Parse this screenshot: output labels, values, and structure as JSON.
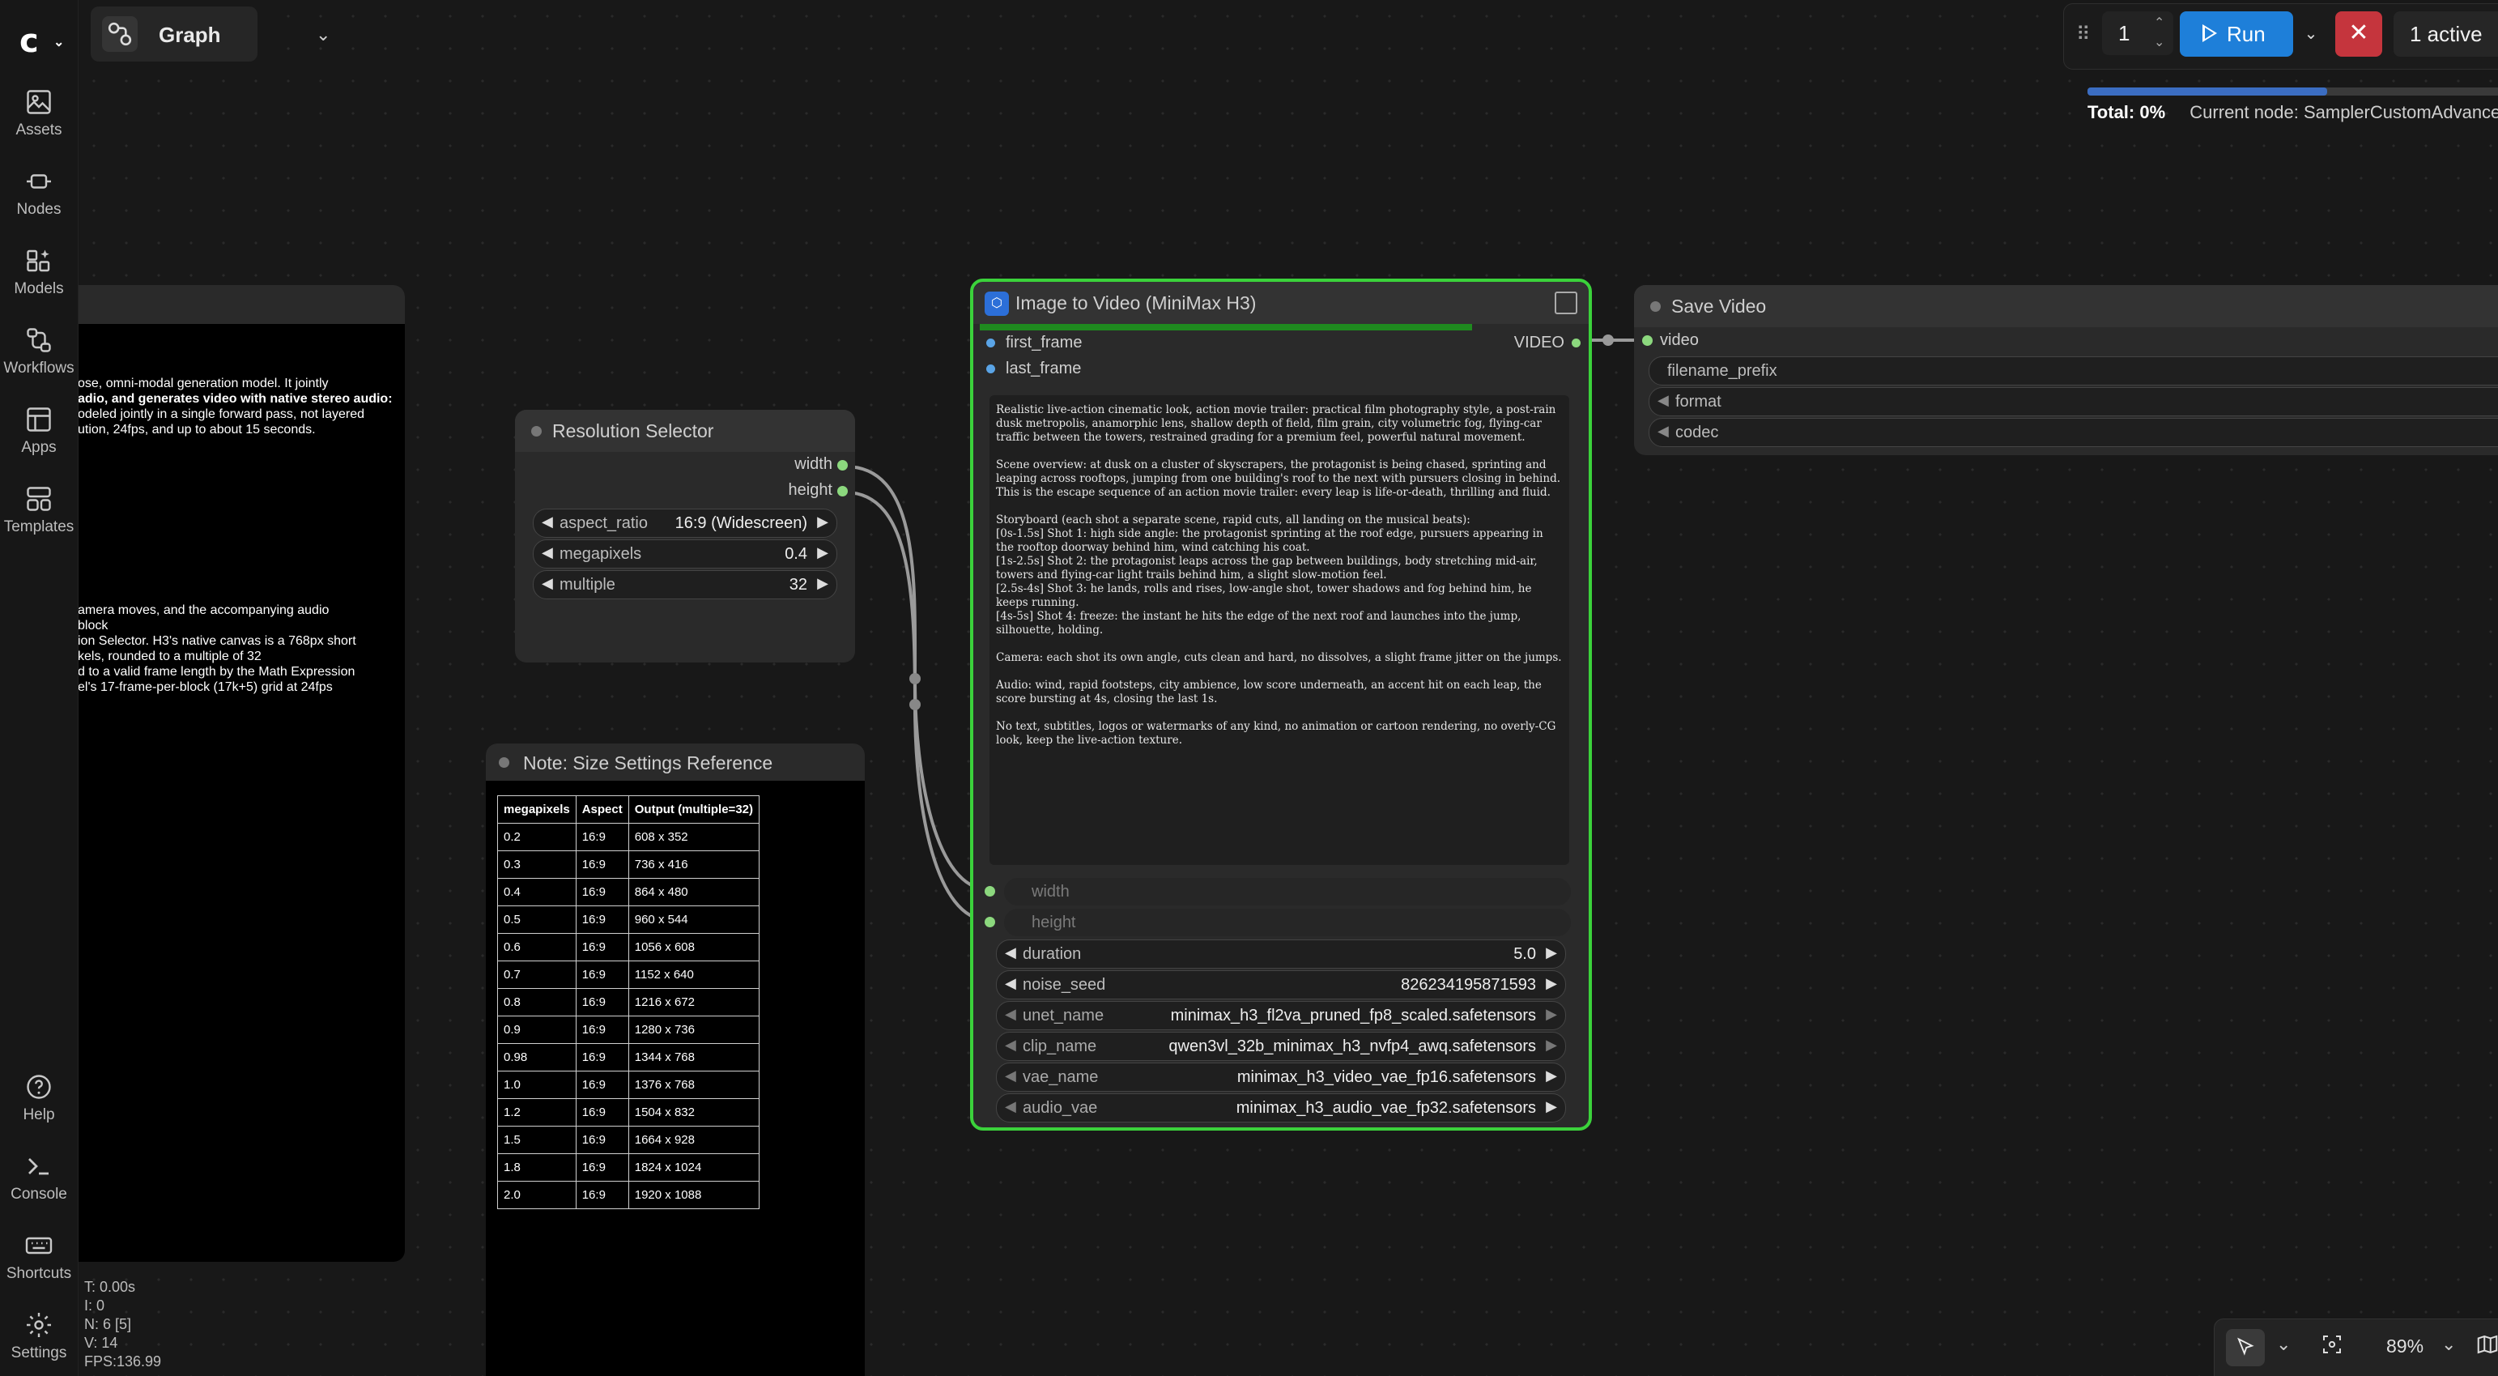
{
  "sidebar": {
    "items": [
      {
        "label": "Assets",
        "icon": "image-icon"
      },
      {
        "label": "Nodes",
        "icon": "node-icon"
      },
      {
        "label": "Models",
        "icon": "models-icon"
      },
      {
        "label": "Workflows",
        "icon": "workflow-icon"
      },
      {
        "label": "Apps",
        "icon": "apps-icon"
      },
      {
        "label": "Templates",
        "icon": "templates-icon"
      }
    ],
    "bottom_items": [
      {
        "label": "Help",
        "icon": "help-icon"
      },
      {
        "label": "Console",
        "icon": "console-icon"
      },
      {
        "label": "Shortcuts",
        "icon": "keyboard-icon"
      },
      {
        "label": "Settings",
        "icon": "gear-icon"
      }
    ]
  },
  "topbar": {
    "graph_label": "Graph",
    "queue_count": "1",
    "run_label": "Run",
    "active_label": "1 active",
    "progress": 0.57,
    "total_label": "Total:",
    "total_value": "0%",
    "current_node_label": "Current node:",
    "current_node_value": "SamplerCustomAdvanced"
  },
  "left_note": {
    "lines": [
      "ose, omni-modal generation model. It jointly",
      "adio, and generates video with native stereo audio:",
      "odeled jointly in a single forward pass, not layered",
      "ution, 24fps, and up to about 15 seconds."
    ],
    "lines2": [
      "amera moves, and the accompanying audio",
      "block",
      "ion Selector. H3's native canvas is a 768px short",
      "kels, rounded to a multiple of 32",
      "d to a valid frame length by the Math Expression",
      "el's 17-frame-per-block (17k+5) grid at 24fps"
    ]
  },
  "resolution_node": {
    "title": "Resolution Selector",
    "outputs": [
      "width",
      "height"
    ],
    "widgets": [
      {
        "name": "aspect_ratio",
        "value": "16:9 (Widescreen)"
      },
      {
        "name": "megapixels",
        "value": "0.4"
      },
      {
        "name": "multiple",
        "value": "32"
      }
    ]
  },
  "size_note": {
    "title": "Note: Size Settings Reference",
    "headers": [
      "megapixels",
      "Aspect",
      "Output (multiple=32)"
    ],
    "rows": [
      [
        "0.2",
        "16:9",
        "608 x 352"
      ],
      [
        "0.3",
        "16:9",
        "736 x 416"
      ],
      [
        "0.4",
        "16:9",
        "864 x 480"
      ],
      [
        "0.5",
        "16:9",
        "960 x 544"
      ],
      [
        "0.6",
        "16:9",
        "1056 x 608"
      ],
      [
        "0.7",
        "16:9",
        "1152 x 640"
      ],
      [
        "0.8",
        "16:9",
        "1216 x 672"
      ],
      [
        "0.9",
        "16:9",
        "1280 x 736"
      ],
      [
        "0.98",
        "16:9",
        "1344 x 768"
      ],
      [
        "1.0",
        "16:9",
        "1376 x 768"
      ],
      [
        "1.2",
        "16:9",
        "1504 x 832"
      ],
      [
        "1.5",
        "16:9",
        "1664 x 928"
      ],
      [
        "1.8",
        "16:9",
        "1824 x 1024"
      ],
      [
        "2.0",
        "16:9",
        "1920 x 1088"
      ]
    ]
  },
  "main_node": {
    "title": "Image to Video (MiniMax H3)",
    "progress": 0.8,
    "inputs": [
      "first_frame",
      "last_frame"
    ],
    "output": "VIDEO",
    "prompt": "Realistic live-action cinematic look, action movie trailer: practical film photography style, a post-rain dusk metropolis, anamorphic lens, shallow depth of field, film grain, city volumetric fog, flying-car traffic between the towers, restrained grading for a premium feel, powerful natural movement.\n\nScene overview: at dusk on a cluster of skyscrapers, the protagonist is being chased, sprinting and leaping across rooftops, jumping from one building's roof to the next with pursuers closing in behind. This is the escape sequence of an action movie trailer: every leap is life-or-death, thrilling and fluid.\n\nStoryboard (each shot a separate scene, rapid cuts, all landing on the musical beats):\n[0s-1.5s] Shot 1: high side angle: the protagonist sprinting at the roof edge, pursuers appearing in the rooftop doorway behind him, wind catching his coat.\n[1s-2.5s] Shot 2: the protagonist leaps across the gap between buildings, body stretching mid-air, towers and flying-car light trails behind him, a slight slow-motion feel.\n[2.5s-4s] Shot 3: he lands, rolls and rises, low-angle shot, tower shadows and fog behind him, he keeps running.\n[4s-5s] Shot 4: freeze: the instant he hits the edge of the next roof and launches into the jump, silhouette, holding.\n\nCamera: each shot its own angle, cuts clean and hard, no dissolves, a slight frame jitter on the jumps.\n\nAudio: wind, rapid footsteps, city ambience, low score underneath, an accent hit on each leap, the score bursting at 4s, closing the last 1s.\n\nNo text, subtitles, logos or watermarks of any kind, no animation or cartoon rendering, no overly-CG look, keep the live-action texture.",
    "ghost_inputs": [
      "width",
      "height"
    ],
    "widgets": [
      {
        "name": "duration",
        "value": "5.0"
      },
      {
        "name": "noise_seed",
        "value": "826234195871593"
      },
      {
        "name": "unet_name",
        "value": "minimax_h3_fl2va_pruned_fp8_scaled.safetensors"
      },
      {
        "name": "clip_name",
        "value": "qwen3vl_32b_minimax_h3_nvfp4_awq.safetensors"
      },
      {
        "name": "vae_name",
        "value": "minimax_h3_video_vae_fp16.safetensors"
      },
      {
        "name": "audio_vae",
        "value": "minimax_h3_audio_vae_fp32.safetensors"
      }
    ]
  },
  "save_node": {
    "title": "Save Video",
    "input": "video",
    "widgets": [
      "filename_prefix",
      "format",
      "codec"
    ]
  },
  "stats": {
    "t": "T: 0.00s",
    "i": "I: 0",
    "n": "N: 6 [5]",
    "v": "V: 14",
    "fps": "FPS:136.99"
  },
  "canvas_tools": {
    "zoom": "89%"
  },
  "colors": {
    "accent": "#1e7fd9",
    "running_border": "#3bd23b",
    "cancel": "#c5353d",
    "socket": "#8cd87e"
  }
}
